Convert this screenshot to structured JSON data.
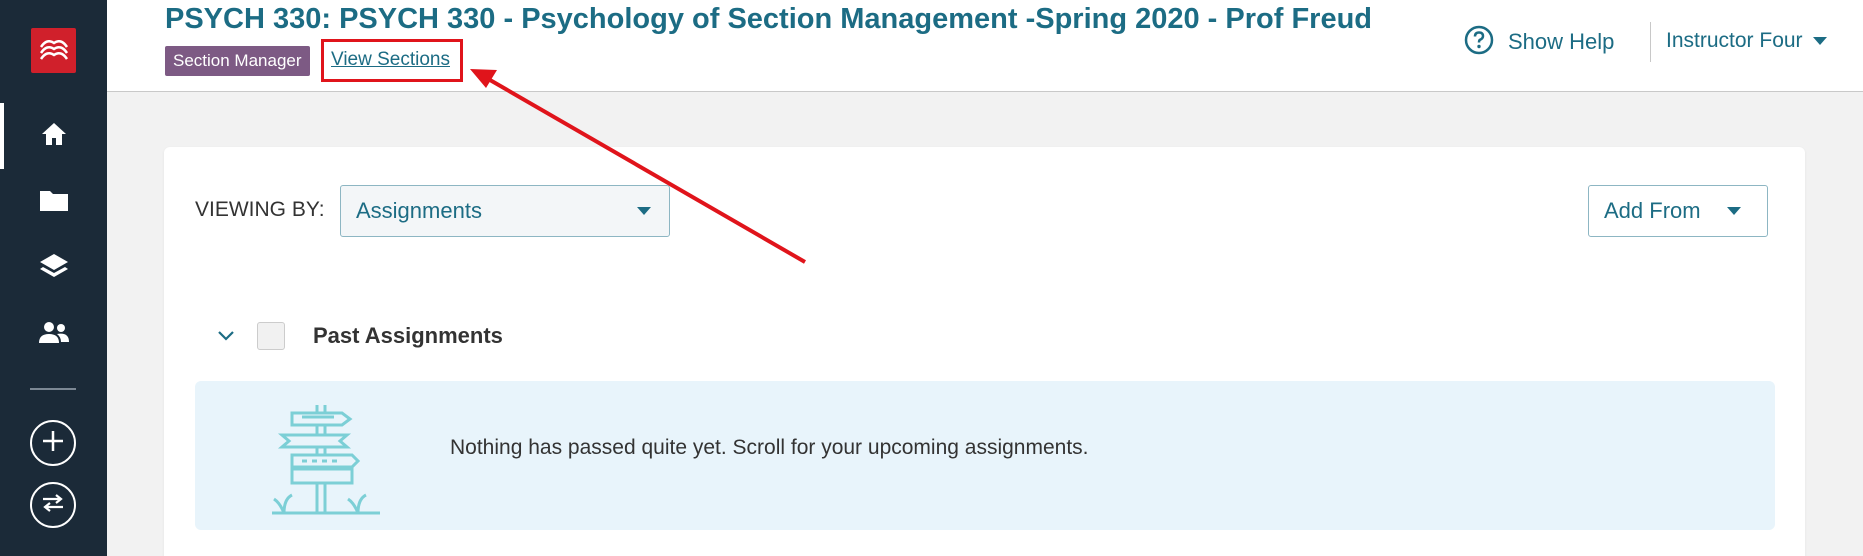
{
  "sidebar": {
    "logo_icon": "mcgraw-hill-logo-icon",
    "items": [
      {
        "icon": "home-icon",
        "active": true
      },
      {
        "icon": "folder-icon",
        "active": false
      },
      {
        "icon": "layers-icon",
        "active": false
      },
      {
        "icon": "people-icon",
        "active": false
      }
    ],
    "add_icon": "plus-circle-icon",
    "switch_icon": "swap-arrows-icon"
  },
  "header": {
    "course_title": "PSYCH 330: PSYCH 330 - Psychology of Section Management -Spring 2020 - Prof Freud",
    "badge": "Section Manager",
    "view_sections": "View Sections",
    "help_label": "Show Help",
    "help_icon": "question-circle-icon",
    "user_name": "Instructor Four"
  },
  "toolbar": {
    "viewing_by_label": "VIEWING BY:",
    "viewing_by_value": "Assignments",
    "add_from_label": "Add From"
  },
  "sections": [
    {
      "title": "Past Assignments",
      "expanded": true,
      "empty_message": "Nothing has passed quite yet. Scroll for your upcoming assignments.",
      "illustration_icon": "signpost-icon"
    }
  ],
  "colors": {
    "sidebar_bg": "#1b2a38",
    "brand_red": "#d0202b",
    "link_teal": "#1c6c84",
    "badge_purple": "#7d5a84",
    "annotation_red": "#e0141b",
    "empty_bg": "#e8f4fb"
  }
}
